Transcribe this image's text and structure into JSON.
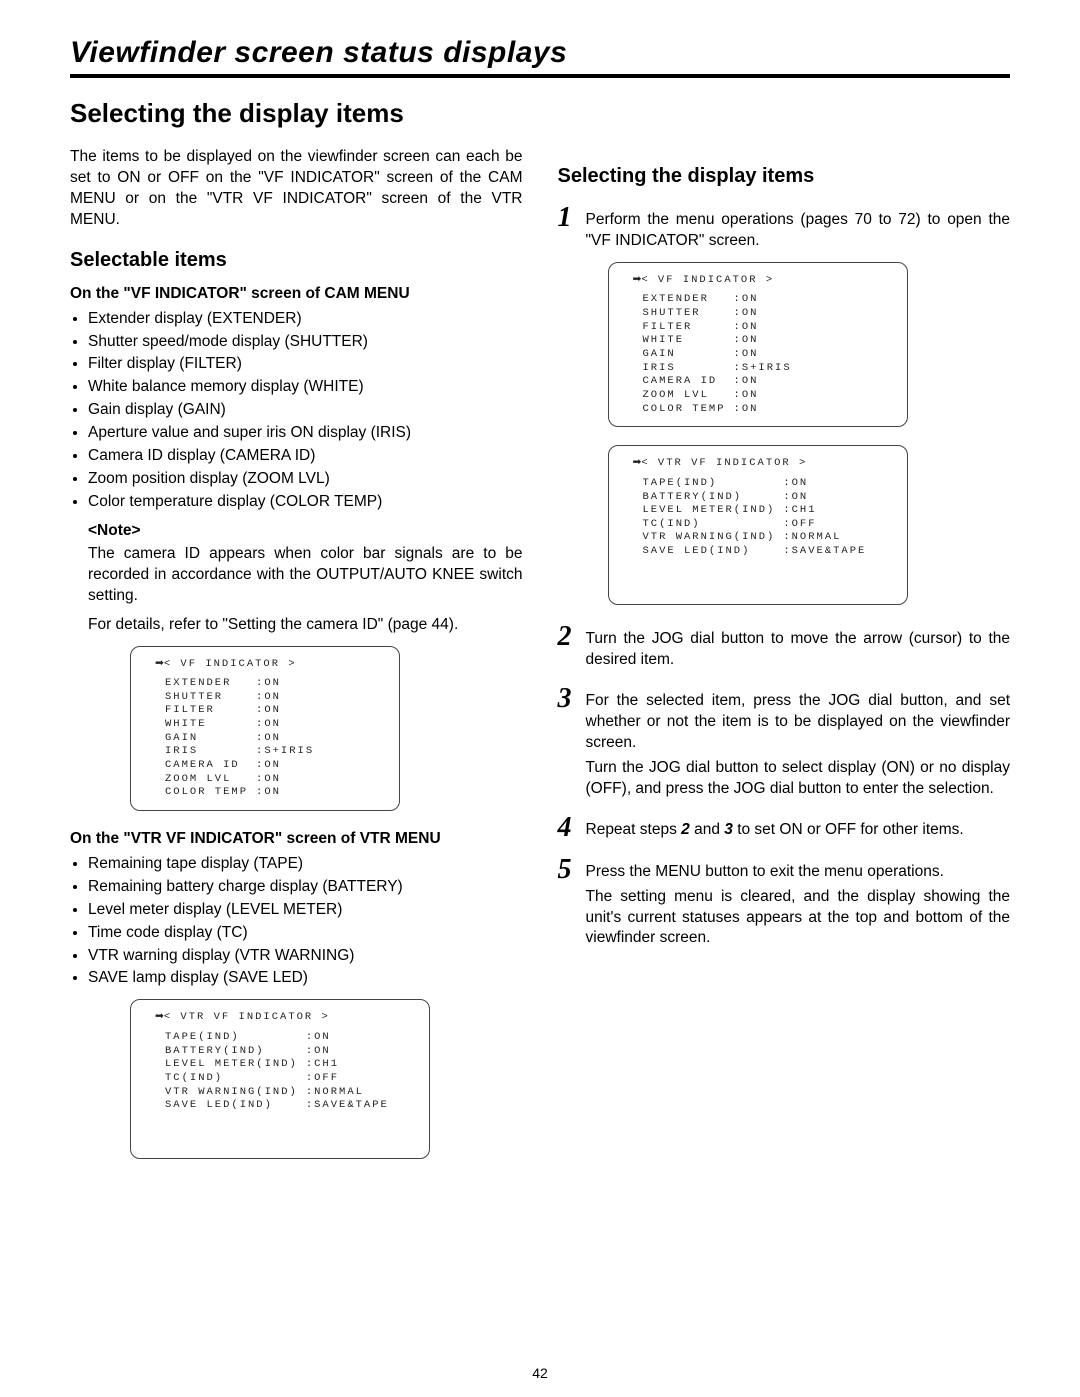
{
  "page_title": "Viewfinder screen status displays",
  "section_title": "Selecting the display items",
  "page_number": "42",
  "left": {
    "intro": "The items to be displayed on the viewfinder screen can each be set to ON or OFF on the \"VF INDICATOR\" screen of the CAM MENU or on the \"VTR VF INDICATOR\" screen of the VTR MENU.",
    "selectable_heading": "Selectable items",
    "cam_heading": "On the \"VF INDICATOR\" screen of CAM MENU",
    "cam_bullets": [
      "Extender display (EXTENDER)",
      "Shutter speed/mode display (SHUTTER)",
      "Filter display (FILTER)",
      "White balance memory display (WHITE)",
      "Gain display (GAIN)",
      "Aperture value and super iris ON display (IRIS)",
      "Camera ID display (CAMERA ID)",
      "Zoom position display (ZOOM LVL)",
      "Color temperature display (COLOR TEMP)"
    ],
    "note_label": "<Note>",
    "note_text1": "The camera ID appears when color bar signals are to be recorded in accordance with the OUTPUT/AUTO KNEE switch setting.",
    "note_text2": "For details, refer to \"Setting the camera ID\" (page 44).",
    "vtr_heading": "On the \"VTR VF INDICATOR\" screen of VTR MENU",
    "vtr_bullets": [
      "Remaining tape display (TAPE)",
      "Remaining battery charge display (BATTERY)",
      "Level meter display (LEVEL METER)",
      "Time code display (TC)",
      "VTR warning display (VTR WARNING)",
      "SAVE lamp display (SAVE LED)"
    ]
  },
  "right": {
    "heading": "Selecting the display items",
    "step1": "Perform the menu operations (pages 70 to 72) to open the \"VF INDICATOR\" screen.",
    "step2": "Turn the JOG dial button to move the arrow (cursor) to the desired item.",
    "step3a": "For the selected item, press the JOG dial button, and set whether or not the item is to be displayed on the viewfinder screen.",
    "step3b": "Turn the JOG dial button to select display (ON) or no display (OFF), and press the JOG dial button to enter the selection.",
    "step4_pre": "Repeat steps ",
    "step4_mid1": "2",
    "step4_mid": " and ",
    "step4_mid2": "3",
    "step4_post": " to set ON or OFF for other items.",
    "step5a": "Press the MENU button to exit the menu operations.",
    "step5b": "The setting menu is cleared, and the display showing the unit's current statuses appears at the top and bottom of the viewfinder screen."
  },
  "menus": {
    "vf": {
      "title": "< VF INDICATOR >",
      "rows": [
        {
          "label": "EXTENDER",
          "value": ":ON"
        },
        {
          "label": "SHUTTER",
          "value": ":ON"
        },
        {
          "label": "FILTER",
          "value": ":ON"
        },
        {
          "label": "WHITE",
          "value": ":ON"
        },
        {
          "label": "GAIN",
          "value": ":ON"
        },
        {
          "label": "IRIS",
          "value": ":S+IRIS"
        },
        {
          "label": "CAMERA ID",
          "value": ":ON"
        },
        {
          "label": "ZOOM LVL",
          "value": ":ON"
        },
        {
          "label": "COLOR TEMP",
          "value": ":ON"
        }
      ]
    },
    "vtr": {
      "title": "< VTR VF INDICATOR >",
      "rows": [
        {
          "label": "TAPE(IND)",
          "value": ":ON"
        },
        {
          "label": "BATTERY(IND)",
          "value": ":ON"
        },
        {
          "label": "LEVEL METER(IND)",
          "value": ":CH1"
        },
        {
          "label": "TC(IND)",
          "value": ":OFF"
        },
        {
          "label": "VTR WARNING(IND)",
          "value": ":NORMAL"
        },
        {
          "label": "SAVE LED(IND)",
          "value": ":SAVE&TAPE"
        }
      ]
    }
  }
}
